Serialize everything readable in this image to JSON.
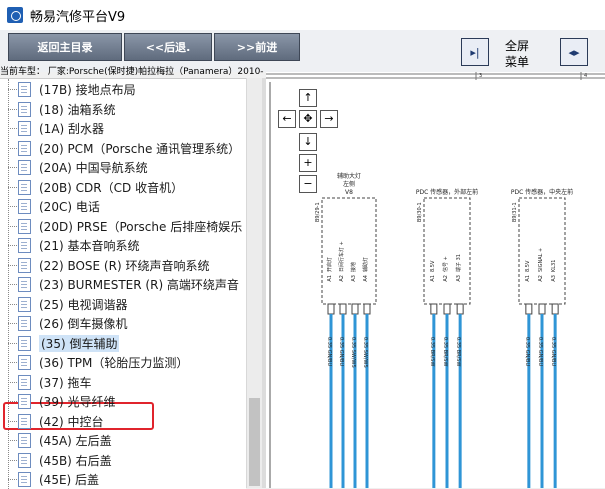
{
  "app": {
    "title": "畅易汽修平台V9"
  },
  "toolbar": {
    "home_label": "返回主目录",
    "back_label": "<<后退.",
    "forward_label": ">>前进",
    "fullscreen_label_1": "全屏",
    "fullscreen_label_2": "菜单"
  },
  "vehicle": {
    "label": "当前车型：  厂家:Porsche(保时捷)帕拉梅拉（Panamera）2010-"
  },
  "tree": {
    "items": [
      "(17B) 接地点布局",
      "(18) 油箱系统",
      "(1A) 刮水器",
      "(20) PCM（Porsche 通讯管理系统）",
      "(20A) 中国导航系统",
      "(20B) CDR（CD 收音机）",
      "(20C) 电话",
      "(20D) PRSE（Porsche 后排座椅娱乐",
      "(21) 基本音响系统",
      "(22) BOSE (R) 环绕声音响系统",
      "(23) BURMESTER (R) 高端环绕声音",
      "(25) 电视调谐器",
      "(26) 倒车摄像机",
      "(35) 倒车辅助",
      "(36) TPM（轮胎压力监测）",
      "(37) 拖车",
      "(39) 光导纤维",
      "(42) 中控台",
      "(45A) 左后盖",
      "(45B) 右后盖",
      "(45E) 后盖"
    ],
    "selected_index": 13
  },
  "diagram": {
    "ruler_marks": [
      "3",
      "4"
    ],
    "components": [
      {
        "code": "B9/29-1",
        "title": "辅助大灯\n左侧\nV8",
        "pins": [
          "A1",
          "A2",
          "A3",
          "A4"
        ],
        "pin_labels": [
          "开启灯",
          "日间行车灯 +",
          "接地",
          "辅助灯"
        ]
      },
      {
        "code": "B9/30-1",
        "title": "PDC 传感器，外部左前",
        "pins": [
          "A1",
          "A2",
          "A3"
        ],
        "pin_labels": [
          "8.5V",
          "信号 +",
          "端子 31"
        ]
      },
      {
        "code": "B9/31-1",
        "title": "PDC 传感器，中央左前",
        "pins": [
          "A1",
          "A2",
          "A3"
        ],
        "pin_labels": [
          "8.5V",
          "SIGNAL +",
          "KL31"
        ]
      }
    ],
    "wire_labels": [
      "0.35 GN/BU",
      "0.35 GN/BU",
      "0.35 SW/WS",
      "0.35 SW/WS",
      "0.35 BR/SW",
      "0.35 BR/SW",
      "0.35 BR/SW",
      "0.35 GN/BU"
    ]
  },
  "colors": {
    "wire": "#2f95d6",
    "selection_outline": "#e0242c",
    "selection_fill": "#cfe3f7"
  }
}
